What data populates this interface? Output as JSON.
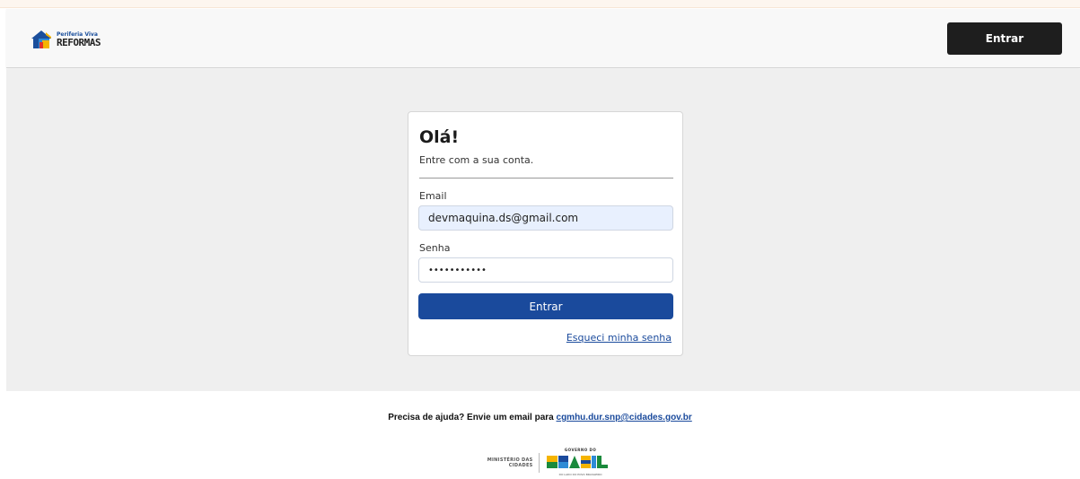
{
  "header": {
    "logo_small": "Periferia Viva",
    "logo_big": "REFORMAS",
    "login_button": "Entrar"
  },
  "card": {
    "title": "Olá!",
    "subtitle": "Entre com a sua conta.",
    "email_label": "Email",
    "email_value": "devmaquina.ds@gmail.com",
    "password_label": "Senha",
    "password_value": "•••••••••••",
    "submit_label": "Entrar",
    "forgot_link": "Esqueci minha senha"
  },
  "footer": {
    "help_text": "Precisa de ajuda? Envie um email para",
    "help_email": "cgmhu.dur.snp@cidades.gov.br",
    "ministry_line1": "MINISTÉRIO DAS",
    "ministry_line2": "CIDADES",
    "gov_top": "GOVERNO DO",
    "gov_word": "BRASIL",
    "gov_bottom": "DO LADO DO POVO BRASILEIRO"
  },
  "colors": {
    "primary": "#1a4a9c",
    "header_button": "#1e1e1e",
    "background": "#efefef"
  }
}
